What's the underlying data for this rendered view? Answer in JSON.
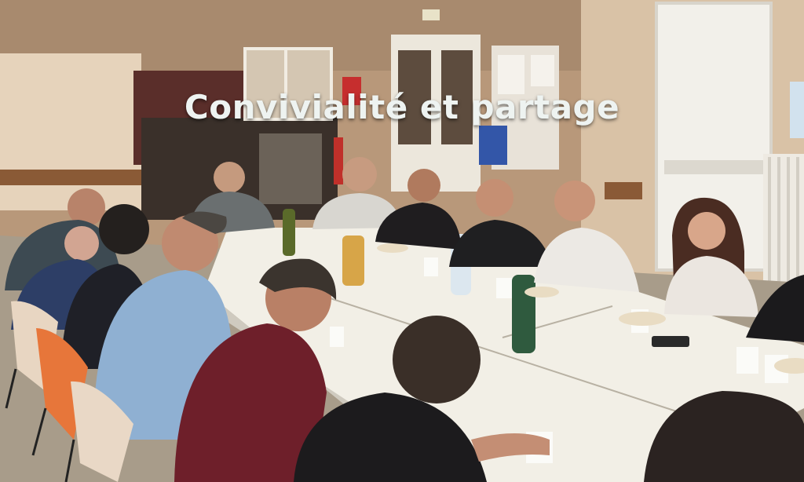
{
  "caption": {
    "text": "Convivialité et partage",
    "color": "#eef3f1"
  },
  "scene": {
    "description_colors": {
      "wall": "#c9a98a",
      "table": "#f2efe6",
      "door": "#e9e6df"
    }
  }
}
